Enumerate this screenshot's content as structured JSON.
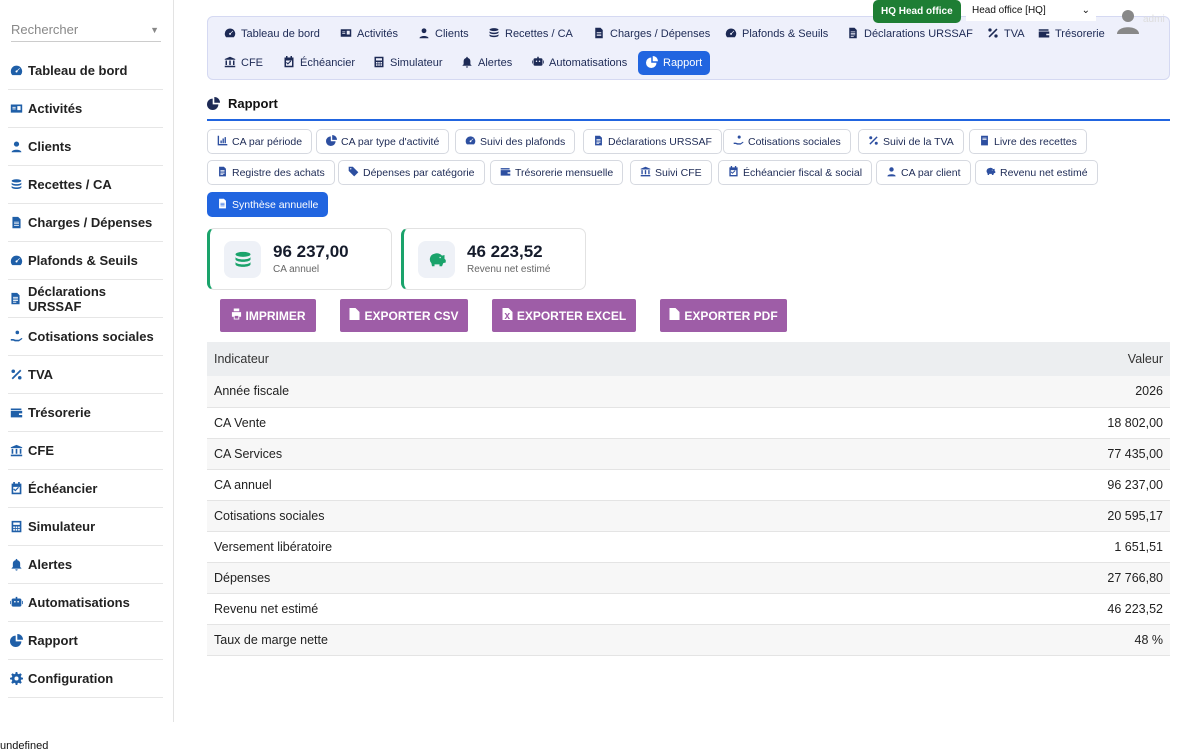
{
  "search": {
    "placeholder": "Rechercher"
  },
  "sidebar": {
    "items": [
      {
        "label": "Tableau de bord",
        "icon": "gauge-icon"
      },
      {
        "label": "Activités",
        "icon": "id-card-icon"
      },
      {
        "label": "Clients",
        "icon": "user-icon"
      },
      {
        "label": "Recettes / CA",
        "icon": "coins-icon"
      },
      {
        "label": "Charges / Dépenses",
        "icon": "file-icon"
      },
      {
        "label": "Plafonds & Seuils",
        "icon": "gauge-icon"
      },
      {
        "label": "Déclarations URSSAF",
        "icon": "file-text-icon"
      },
      {
        "label": "Cotisations sociales",
        "icon": "hand-coins-icon"
      },
      {
        "label": "TVA",
        "icon": "percent-icon"
      },
      {
        "label": "Trésorerie",
        "icon": "wallet-icon"
      },
      {
        "label": "CFE",
        "icon": "building-icon"
      },
      {
        "label": "Échéancier",
        "icon": "calendar-icon"
      },
      {
        "label": "Simulateur",
        "icon": "calculator-icon"
      },
      {
        "label": "Alertes",
        "icon": "bell-icon"
      },
      {
        "label": "Automatisations",
        "icon": "robot-icon"
      },
      {
        "label": "Rapport",
        "icon": "pie-chart-icon"
      },
      {
        "label": "Configuration",
        "icon": "gear-icon"
      }
    ]
  },
  "topnav": {
    "row1": [
      {
        "label": "Tableau de bord",
        "icon": "gauge-icon"
      },
      {
        "label": "Activités",
        "icon": "id-card-icon"
      },
      {
        "label": "Clients",
        "icon": "user-icon"
      },
      {
        "label": "Recettes / CA",
        "icon": "coins-icon"
      },
      {
        "label": "Charges / Dépenses",
        "icon": "file-icon"
      },
      {
        "label": "Plafonds & Seuils",
        "icon": "gauge-icon"
      },
      {
        "label": "Déclarations URSSAF",
        "icon": "file-text-icon"
      },
      {
        "label": "TVA",
        "icon": "percent-icon"
      },
      {
        "label": "Trésorerie",
        "icon": "wallet-icon"
      }
    ],
    "row2": [
      {
        "label": "CFE",
        "icon": "building-icon"
      },
      {
        "label": "Échéancier",
        "icon": "calendar-icon"
      },
      {
        "label": "Simulateur",
        "icon": "calculator-icon"
      },
      {
        "label": "Alertes",
        "icon": "bell-icon"
      },
      {
        "label": "Automatisations",
        "icon": "robot-icon"
      },
      {
        "label": "Rapport",
        "icon": "pie-chart-icon",
        "active": true
      }
    ]
  },
  "office": {
    "badge": "HQ Head office",
    "selected": "Head office [HQ]",
    "faded_label": "admi"
  },
  "report": {
    "title": "Rapport",
    "buttons_row1": [
      {
        "label": "CA par période",
        "icon": "chart-icon"
      },
      {
        "label": "CA par type d'activité",
        "icon": "pie-chart-icon"
      },
      {
        "label": "Suivi des plafonds",
        "icon": "gauge-icon"
      },
      {
        "label": "Déclarations URSSAF",
        "icon": "file-text-icon"
      },
      {
        "label": "Cotisations sociales",
        "icon": "hand-coins-icon"
      },
      {
        "label": "Suivi de la TVA",
        "icon": "percent-icon"
      },
      {
        "label": "Livre des recettes",
        "icon": "book-icon"
      }
    ],
    "buttons_row2": [
      {
        "label": "Registre des achats",
        "icon": "file-text-icon"
      },
      {
        "label": "Dépenses par catégorie",
        "icon": "tags-icon"
      },
      {
        "label": "Trésorerie mensuelle",
        "icon": "wallet-icon"
      },
      {
        "label": "Suivi CFE",
        "icon": "building-icon"
      },
      {
        "label": "Échéancier fiscal & social",
        "icon": "calendar-icon"
      },
      {
        "label": "CA par client",
        "icon": "user-icon"
      },
      {
        "label": "Revenu net estimé",
        "icon": "piggy-bank-icon"
      }
    ],
    "buttons_row3": [
      {
        "label": "Synthèse annuelle",
        "icon": "file-icon",
        "active": true
      }
    ]
  },
  "kpis": [
    {
      "value": "96 237,00",
      "label": "CA annuel",
      "icon": "coins-icon"
    },
    {
      "value": "46 223,52",
      "label": "Revenu net estimé",
      "icon": "piggy-bank-icon"
    }
  ],
  "export": {
    "print": "IMPRIMER",
    "csv": "EXPORTER CSV",
    "excel": "EXPORTER EXCEL",
    "pdf": "EXPORTER PDF"
  },
  "table": {
    "headers": [
      "Indicateur",
      "Valeur"
    ],
    "rows": [
      [
        "Année fiscale",
        "2026"
      ],
      [
        "CA Vente",
        "18 802,00"
      ],
      [
        "CA Services",
        "77 435,00"
      ],
      [
        "CA annuel",
        "96 237,00"
      ],
      [
        "Cotisations sociales",
        "20 595,17"
      ],
      [
        "Versement libératoire",
        "1 651,51"
      ],
      [
        "Dépenses",
        "27 766,80"
      ],
      [
        "Revenu net estimé",
        "46 223,52"
      ],
      [
        "Taux de marge nette",
        "48 %"
      ]
    ]
  },
  "footer_text": "undefined",
  "colors": {
    "accent": "#2165e0",
    "export_button": "#9e5da7",
    "kpi_border": "#1aa36b",
    "office_badge": "#1e7e34"
  }
}
